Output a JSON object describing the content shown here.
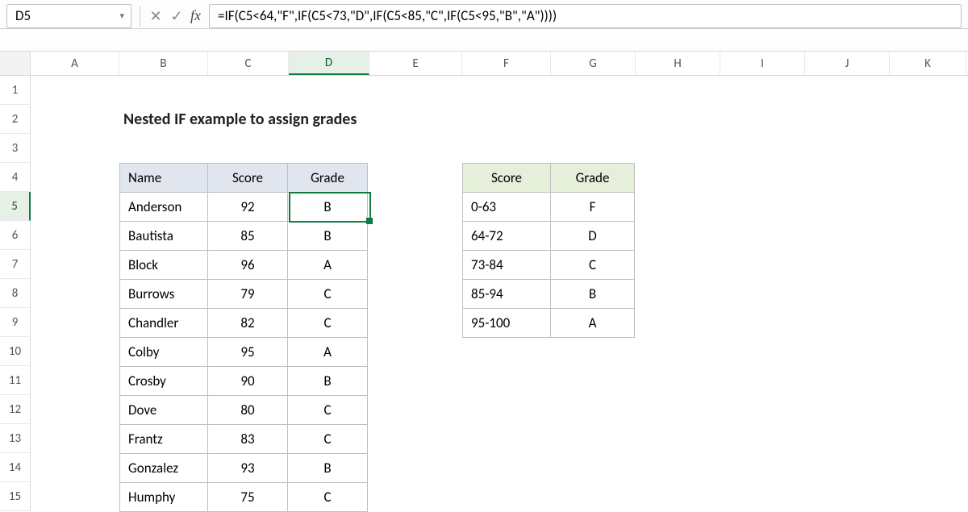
{
  "name_box": "D5",
  "formula": "=IF(C5<64,\"F\",IF(C5<73,\"D\",IF(C5<85,\"C\",IF(C5<95,\"B\",\"A\"))))",
  "columns": [
    "A",
    "B",
    "C",
    "D",
    "E",
    "F",
    "G",
    "H",
    "I",
    "J",
    "K"
  ],
  "rows": [
    "1",
    "2",
    "3",
    "4",
    "5",
    "6",
    "7",
    "8",
    "9",
    "10",
    "11",
    "12",
    "13",
    "14",
    "15"
  ],
  "active_column": "D",
  "active_row": "5",
  "title": "Nested IF example to assign grades",
  "main_table": {
    "headers": {
      "name": "Name",
      "score": "Score",
      "grade": "Grade"
    },
    "rows": [
      {
        "name": "Anderson",
        "score": "92",
        "grade": "B"
      },
      {
        "name": "Bautista",
        "score": "85",
        "grade": "B"
      },
      {
        "name": "Block",
        "score": "96",
        "grade": "A"
      },
      {
        "name": "Burrows",
        "score": "79",
        "grade": "C"
      },
      {
        "name": "Chandler",
        "score": "82",
        "grade": "C"
      },
      {
        "name": "Colby",
        "score": "95",
        "grade": "A"
      },
      {
        "name": "Crosby",
        "score": "90",
        "grade": "B"
      },
      {
        "name": "Dove",
        "score": "80",
        "grade": "C"
      },
      {
        "name": "Frantz",
        "score": "83",
        "grade": "C"
      },
      {
        "name": "Gonzalez",
        "score": "93",
        "grade": "B"
      },
      {
        "name": "Humphy",
        "score": "75",
        "grade": "C"
      }
    ]
  },
  "lookup_table": {
    "headers": {
      "score": "Score",
      "grade": "Grade"
    },
    "rows": [
      {
        "score": "0-63",
        "grade": "F"
      },
      {
        "score": "64-72",
        "grade": "D"
      },
      {
        "score": "73-84",
        "grade": "C"
      },
      {
        "score": "85-94",
        "grade": "B"
      },
      {
        "score": "95-100",
        "grade": "A"
      }
    ]
  }
}
